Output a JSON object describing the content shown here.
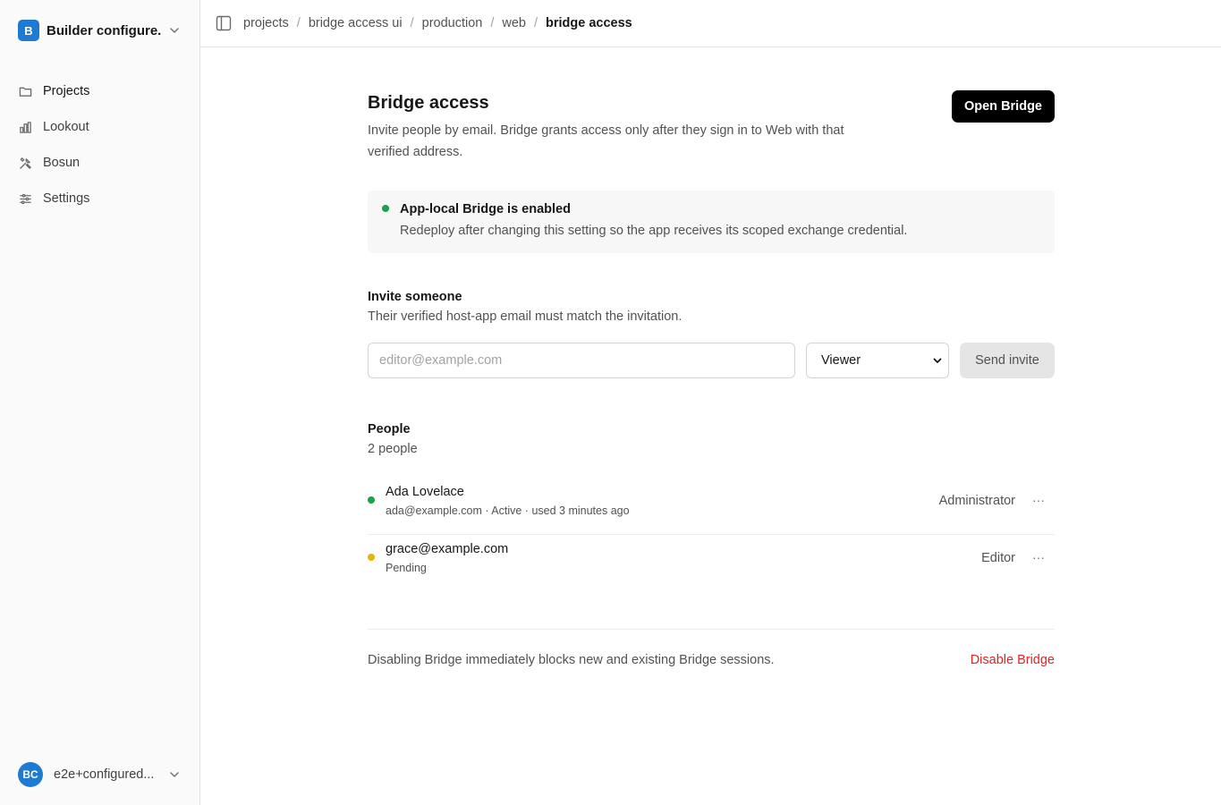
{
  "sidebar": {
    "org": {
      "initial": "B",
      "name": "Builder configure...",
      "badge_color": "#1f7bd1"
    },
    "items": [
      {
        "label": "Projects",
        "icon": "folder-icon"
      },
      {
        "label": "Lookout",
        "icon": "bar-chart-icon"
      },
      {
        "label": "Bosun",
        "icon": "tools-icon"
      },
      {
        "label": "Settings",
        "icon": "sliders-icon"
      }
    ],
    "user": {
      "initials": "BC",
      "name": "e2e+configured..."
    }
  },
  "breadcrumb": [
    "projects",
    "bridge access ui",
    "production",
    "web",
    "bridge access"
  ],
  "page": {
    "title": "Bridge access",
    "description": "Invite people by email. Bridge grants access only after they sign in to Web with that verified address.",
    "open_button": "Open Bridge"
  },
  "status": {
    "title": "App-local Bridge is enabled",
    "description": "Redeploy after changing this setting so the app receives its scoped exchange credential.",
    "color": "#16a34a"
  },
  "invite": {
    "title": "Invite someone",
    "subtitle": "Their verified host-app email must match the invitation.",
    "email_placeholder": "editor@example.com",
    "role_selected": "Viewer",
    "send_label": "Send invite"
  },
  "people": {
    "title": "People",
    "count_label": "2 people",
    "list": [
      {
        "name": "Ada Lovelace",
        "meta": "ada@example.com · Active · used 3 minutes ago",
        "role": "Administrator",
        "status_color": "#16a34a",
        "more": "···"
      },
      {
        "name": "grace@example.com",
        "meta": "Pending",
        "role": "Editor",
        "status_color": "#eab308",
        "more": "···"
      }
    ]
  },
  "danger": {
    "text": "Disabling Bridge immediately blocks new and existing Bridge sessions.",
    "button": "Disable Bridge",
    "color": "#dc2626"
  }
}
